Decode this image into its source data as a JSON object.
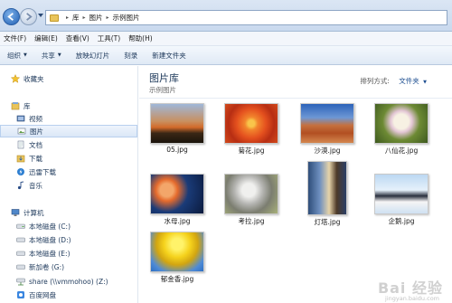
{
  "address": {
    "breadcrumbs": [
      "库",
      "图片",
      "示例图片"
    ]
  },
  "menu": [
    "文件(F)",
    "编辑(E)",
    "查看(V)",
    "工具(T)",
    "帮助(H)"
  ],
  "commands": {
    "organize": "组织",
    "share": "共享",
    "slideshow": "放映幻灯片",
    "burn": "刻录",
    "new_folder": "新建文件夹"
  },
  "sidebar": {
    "favorites": "收藏夹",
    "library": "库",
    "video": "视频",
    "pictures": "图片",
    "documents": "文档",
    "downloads": "下载",
    "thunder": "迅雷下载",
    "music": "音乐",
    "computer": "计算机",
    "drive_c": "本地磁盘 (C:)",
    "drive_d": "本地磁盘 (D:)",
    "drive_e": "本地磁盘 (E:)",
    "drive_g": "新加卷 (G:)",
    "share_z": "share (\\\\vmmohoo) (Z:)",
    "baidu": "百度网盘"
  },
  "main": {
    "title": "图片库",
    "subtitle": "示例图片",
    "arrange_label": "排列方式:",
    "arrange_value": "文件夹"
  },
  "files": [
    {
      "name": "05.jpg"
    },
    {
      "name": "菊花.jpg"
    },
    {
      "name": "沙漠.jpg"
    },
    {
      "name": "八仙花.jpg"
    },
    {
      "name": "水母.jpg"
    },
    {
      "name": "考拉.jpg"
    },
    {
      "name": "灯塔.jpg"
    },
    {
      "name": "企鹅.jpg"
    },
    {
      "name": "郁金香.jpg"
    }
  ],
  "watermark": {
    "text": "Bai 经验",
    "url": "jingyan.baidu.com"
  },
  "colors": {
    "accent": "#1e4f91",
    "selection": "#dbe7f7"
  }
}
